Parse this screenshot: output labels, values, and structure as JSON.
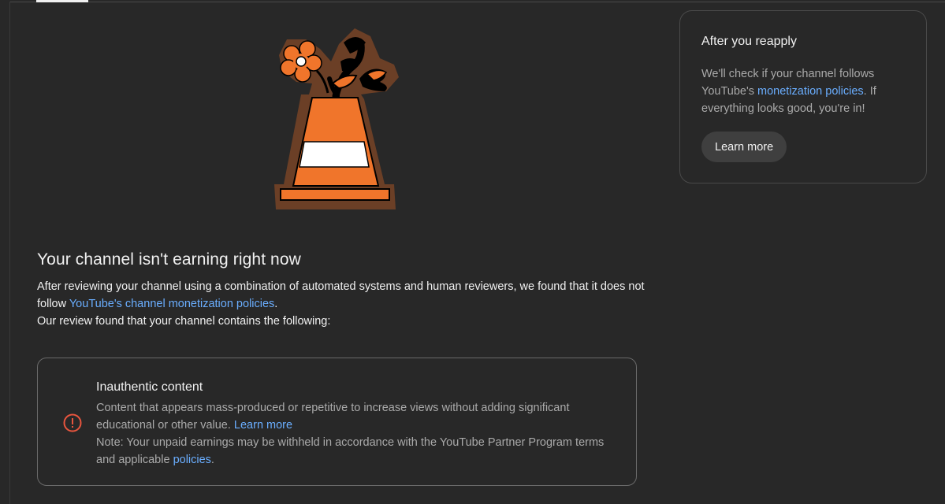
{
  "header": {
    "active_tab_indicator": true
  },
  "illustration": {
    "icon": "traffic-cone-with-flowers-illustration",
    "colors": {
      "cone": "#f0752b",
      "outline": "#6b3f26",
      "stripe": "#ffffff",
      "ink": "#000000"
    }
  },
  "main": {
    "title": "Your channel isn't earning right now",
    "description_prefix": "After reviewing your channel using a combination of automated systems and human reviewers, we found that it does not follow ",
    "description_link": "YouTube's channel monetization policies",
    "description_suffix": ".",
    "review_intro": "Our review found that your channel contains the following:"
  },
  "issue": {
    "icon": "alert-circle-icon",
    "title": "Inauthentic content",
    "body_text": "Content that appears mass-produced or repetitive to increase views without adding significant educational or other value. ",
    "learn_more_link": "Learn more",
    "note_text": "Note: Your unpaid earnings may be withheld in accordance with the YouTube Partner Program terms and applicable ",
    "policies_link": "policies",
    "note_suffix": "."
  },
  "sidebar": {
    "title": "After you reapply",
    "body_prefix": "We'll check if your channel follows YouTube's ",
    "body_link": "monetization policies",
    "body_suffix": ". If everything looks good, you're in!",
    "button_label": "Learn more"
  },
  "colors": {
    "background": "#282828",
    "text": "#f1f1f1",
    "muted_text": "#aaaaaa",
    "link": "#6aaeff",
    "alert": "#e8553e",
    "button_bg": "#3f3f3f"
  }
}
